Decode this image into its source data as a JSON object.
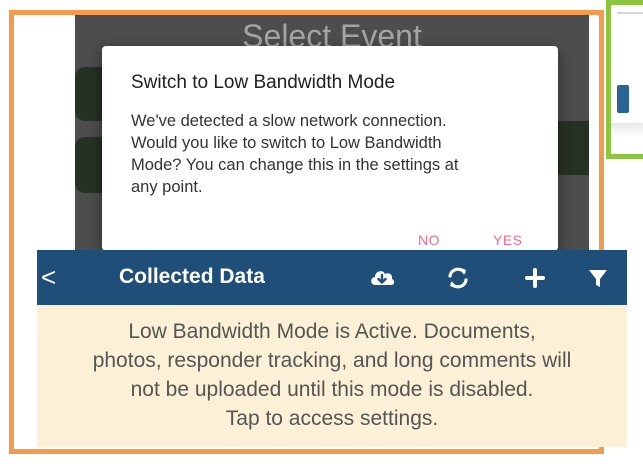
{
  "background_screen": {
    "title": "Select Event"
  },
  "dialog": {
    "title": "Switch to Low Bandwidth Mode",
    "body": "We've detected a slow network connection.\nWould you like to switch to Low Bandwidth\nMode?  You can change this in the settings at\nany point.",
    "no_label": "NO",
    "yes_label": "YES",
    "accent_color": "#f06a8c"
  },
  "navbar": {
    "back_glyph": "<",
    "title": "Collected Data",
    "icons": [
      "cloud-download-icon",
      "sync-icon",
      "plus-icon",
      "filter-icon"
    ],
    "color": "#1f4e79"
  },
  "banner": {
    "text": "Low Bandwidth Mode is Active.  Documents,\nphotos, responder tracking, and long comments will\nnot be uploaded until this mode is disabled.\nTap to access settings.",
    "color": "#fcf1d6"
  },
  "frames": {
    "orange": "#f39a4c",
    "green": "#8cc63e"
  }
}
